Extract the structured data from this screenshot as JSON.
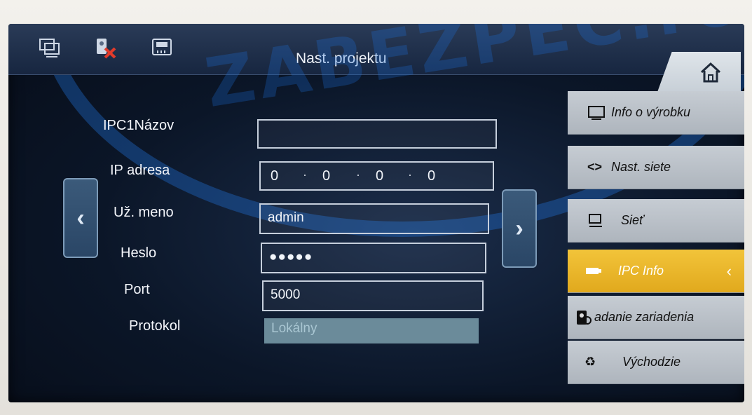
{
  "watermark": "ZABEZPEC.ro",
  "header": {
    "title": "Nast. projektu",
    "icons": [
      "monitor-icon",
      "device-offline-icon",
      "sd-card-icon",
      "home-icon"
    ]
  },
  "form": {
    "fields": [
      {
        "label": "IPC1Názov",
        "value": ""
      },
      {
        "label": "IP adresa",
        "value": [
          "0",
          "0",
          "0",
          "0"
        ]
      },
      {
        "label": "Už. meno",
        "value": "admin"
      },
      {
        "label": "Heslo",
        "value": "●●●●●"
      },
      {
        "label": "Port",
        "value": "5000"
      },
      {
        "label": "Protokol",
        "value": "Lokálny"
      }
    ]
  },
  "sidebar": {
    "items": [
      {
        "label": "Info o výrobku",
        "icon": "monitor-icon"
      },
      {
        "label": "Nast. siete",
        "icon": "code-arrows-icon"
      },
      {
        "label": "Sieť",
        "icon": "network-monitor-icon"
      },
      {
        "label": "IPC Info",
        "icon": "camera-icon",
        "active": true
      },
      {
        "label": "adanie zariadenia",
        "icon": "device-search-icon"
      },
      {
        "label": "Východzie",
        "icon": "recycle-icon"
      }
    ]
  },
  "colors": {
    "accent": "#e8b62c",
    "background": "#0b1628",
    "sidebar": "#bcc3cb"
  }
}
